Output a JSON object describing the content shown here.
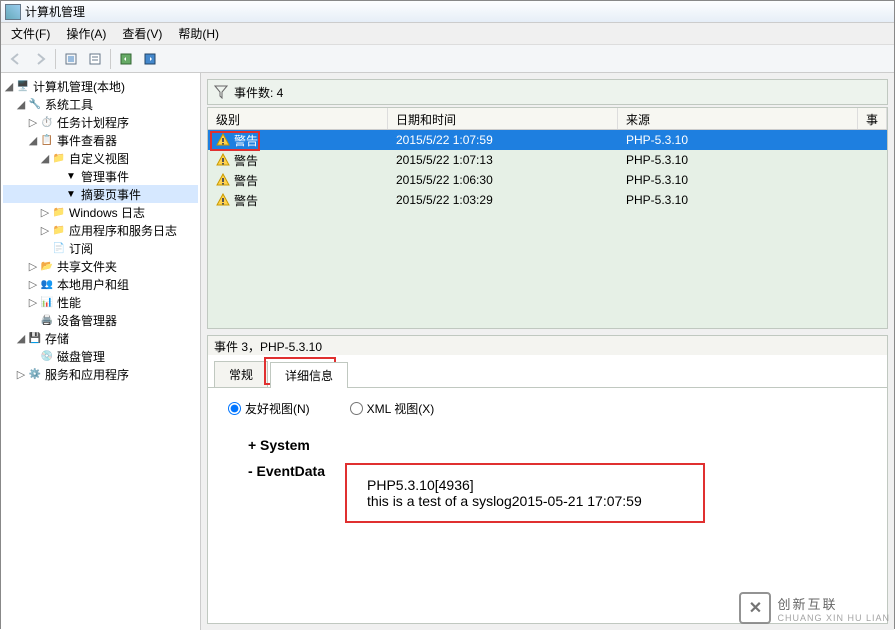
{
  "window": {
    "title": "计算机管理"
  },
  "menu": {
    "file": "文件(F)",
    "action": "操作(A)",
    "view": "查看(V)",
    "help": "帮助(H)"
  },
  "tree": {
    "root": "计算机管理(本地)",
    "system_tools": "系统工具",
    "task_scheduler": "任务计划程序",
    "event_viewer": "事件查看器",
    "custom_views": "自定义视图",
    "admin_events": "管理事件",
    "summary_events": "摘要页事件",
    "windows_logs": "Windows 日志",
    "app_service_logs": "应用程序和服务日志",
    "subscriptions": "订阅",
    "shared_folders": "共享文件夹",
    "local_users": "本地用户和组",
    "performance": "性能",
    "device_manager": "设备管理器",
    "storage": "存储",
    "disk_mgmt": "磁盘管理",
    "services_apps": "服务和应用程序"
  },
  "filter": {
    "count_label": "事件数: 4"
  },
  "columns": {
    "level": "级别",
    "datetime": "日期和时间",
    "source": "来源",
    "event": "事件"
  },
  "rows": [
    {
      "level": "警告",
      "datetime": "2015/5/22 1:07:59",
      "source": "PHP-5.3.10",
      "selected": true
    },
    {
      "level": "警告",
      "datetime": "2015/5/22 1:07:13",
      "source": "PHP-5.3.10",
      "selected": false
    },
    {
      "level": "警告",
      "datetime": "2015/5/22 1:06:30",
      "source": "PHP-5.3.10",
      "selected": false
    },
    {
      "level": "警告",
      "datetime": "2015/5/22 1:03:29",
      "source": "PHP-5.3.10",
      "selected": false
    }
  ],
  "detail": {
    "header": "事件 3，PHP-5.3.10",
    "tab_general": "常规",
    "tab_details": "详细信息",
    "radio_friendly": "友好视图(N)",
    "radio_xml": "XML 视图(X)",
    "system_label": "+  System",
    "eventdata_label": "-  EventData",
    "msg_line1": "PHP5.3.10[4936]",
    "msg_line2": "this is a test of a syslog2015-05-21 17:07:59"
  },
  "watermark": {
    "brand": "创新互联",
    "sub": "CHUANG XIN HU LIAN"
  }
}
